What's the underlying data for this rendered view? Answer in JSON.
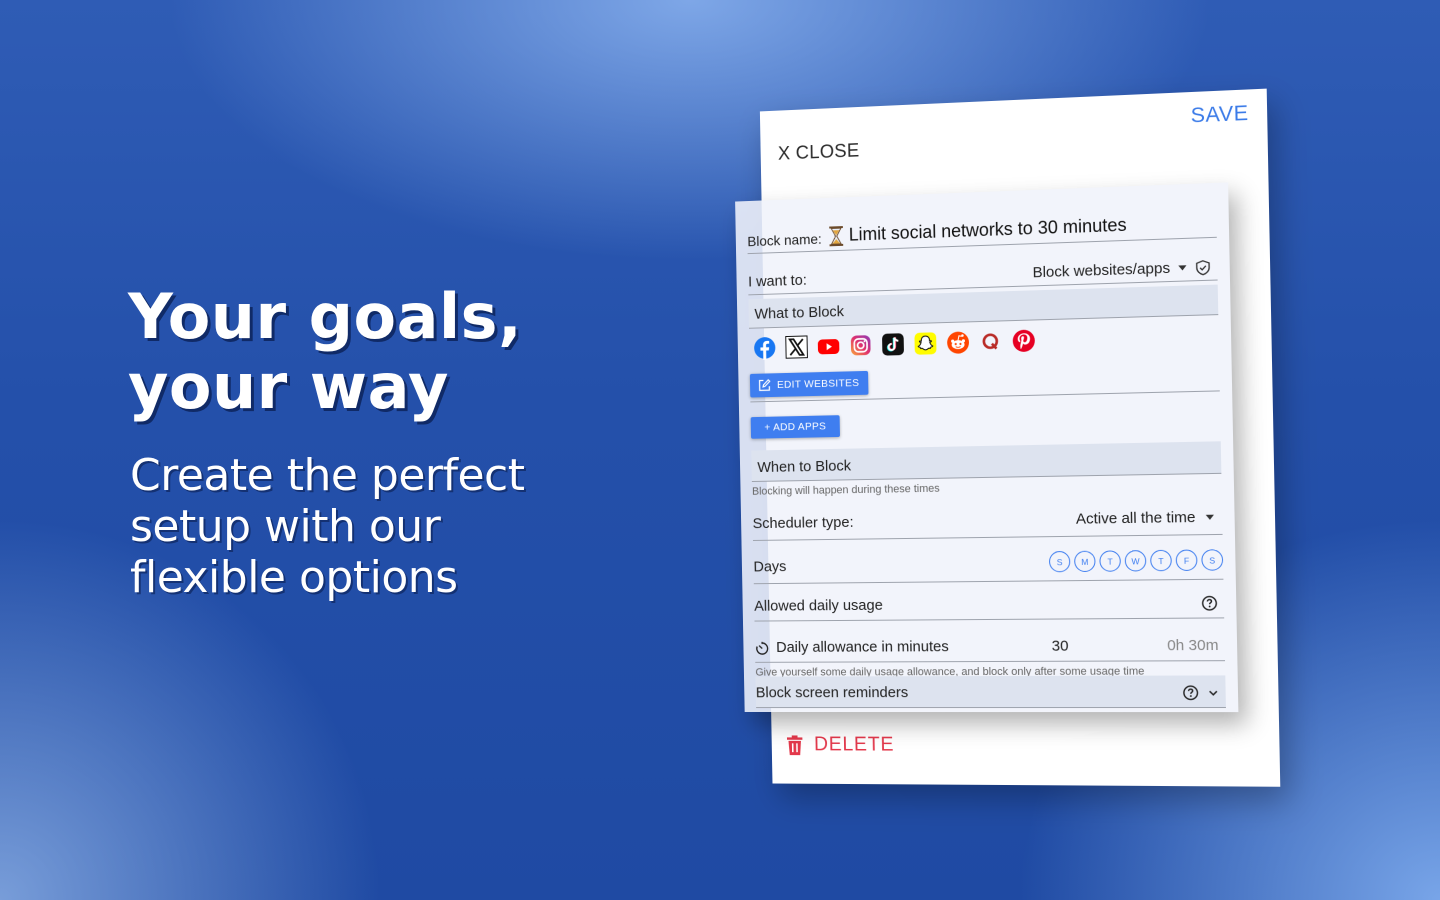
{
  "marketing": {
    "headline_line1": "Your goals,",
    "headline_line2": "your way",
    "sub_line1": "Create the perfect",
    "sub_line2": "setup with our",
    "sub_line3": "flexible options"
  },
  "dialog": {
    "close_label": "X CLOSE",
    "save_label": "SAVE",
    "delete_label": "DELETE"
  },
  "form": {
    "block_name_label": "Block name:",
    "block_name_value": "Limit social networks to 30 minutes",
    "i_want_to_label": "I want to:",
    "i_want_to_value": "Block websites/apps",
    "what_to_block_label": "What to Block",
    "blocked_site_icons": [
      "facebook-icon",
      "x-icon",
      "youtube-icon",
      "instagram-icon",
      "tiktok-icon",
      "snapchat-icon",
      "reddit-icon",
      "quora-icon",
      "pinterest-icon"
    ],
    "edit_websites_label": "EDIT WEBSITES",
    "add_apps_label": "+ ADD APPS",
    "when_to_block_label": "When to Block",
    "when_hint": "Blocking will happen during these times",
    "scheduler_type_label": "Scheduler type:",
    "scheduler_type_value": "Active all the time",
    "days_label": "Days",
    "days": [
      "S",
      "M",
      "T",
      "W",
      "T",
      "F",
      "S"
    ],
    "allowed_daily_usage_label": "Allowed daily usage",
    "daily_allowance_label": "Daily allowance in minutes",
    "daily_allowance_value": "30",
    "daily_allowance_formatted": "0h 30m",
    "allowance_hint": "Give yourself some daily usage allowance, and block only after some usage time",
    "block_screen_reminders_label": "Block screen reminders"
  },
  "colors": {
    "accent_blue": "#3f7ef0",
    "save_blue": "#3b7be8",
    "delete_red": "#e3384b"
  }
}
